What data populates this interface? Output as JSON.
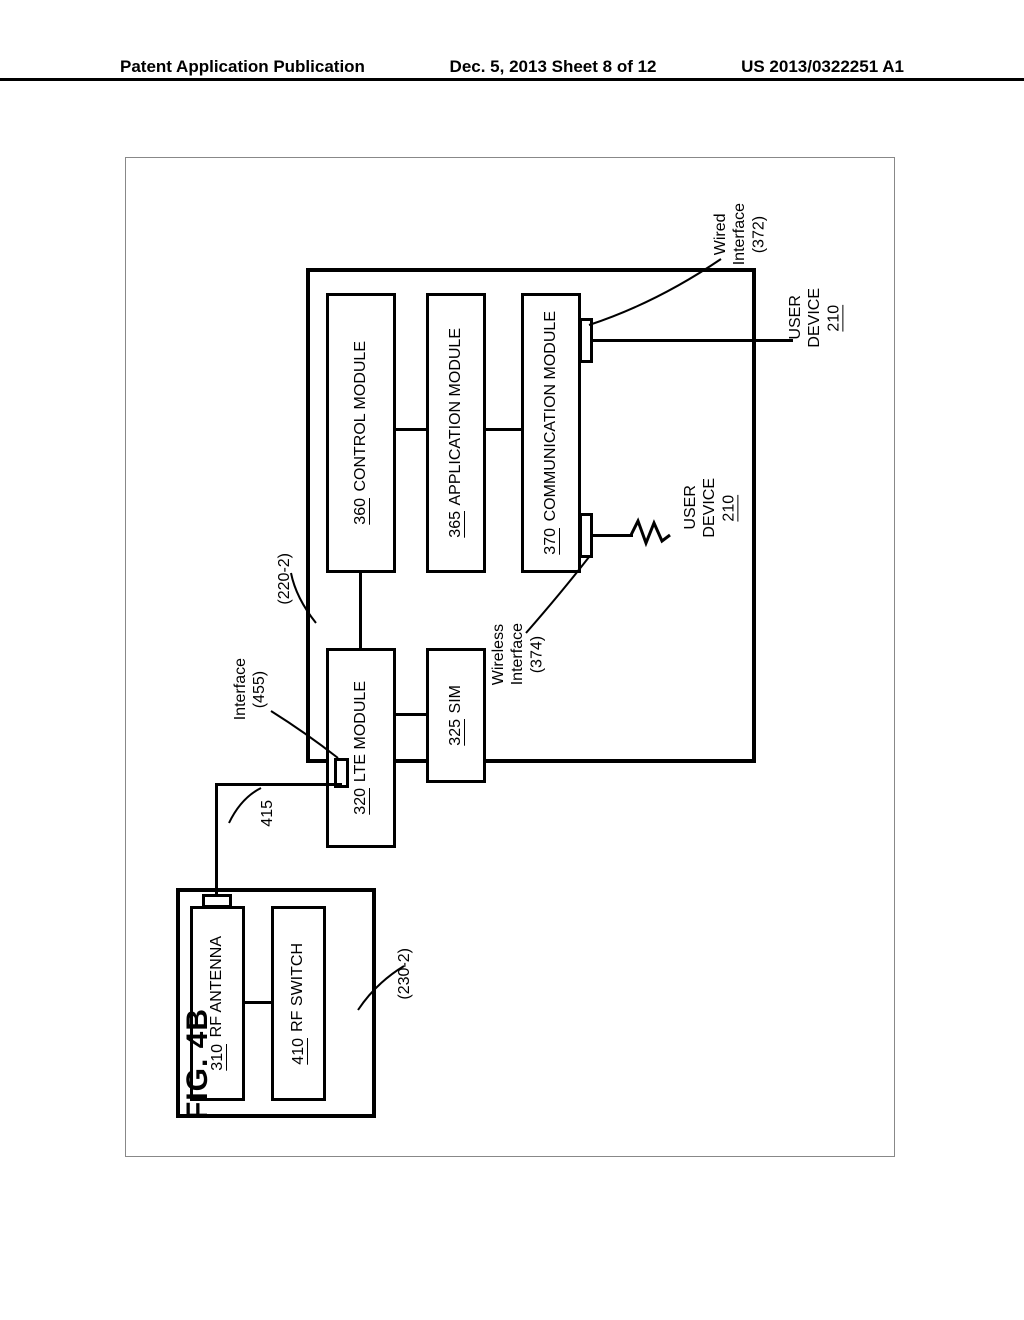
{
  "header": {
    "left": "Patent Application Publication",
    "center": "Dec. 5, 2013  Sheet 8 of 12",
    "right": "US 2013/0322251 A1"
  },
  "figure_label": "FIG. 4B",
  "container_refs": {
    "outdoor": "(230-2)",
    "indoor": "(220-2)"
  },
  "cable_ref": "415",
  "interface_label": "Interface",
  "interface_ref": "(455)",
  "wireless_iface_label": "Wireless\nInterface",
  "wireless_iface_ref": "(374)",
  "wired_iface_label": "Wired\nInterface",
  "wired_iface_ref": "(372)",
  "boxes": {
    "rf_antenna": {
      "label": "RF ANTENNA",
      "ref": "310"
    },
    "rf_switch": {
      "label": "RF SWITCH",
      "ref": "410"
    },
    "lte_module": {
      "label": "LTE MODULE",
      "ref": "320"
    },
    "sim": {
      "label": "SIM",
      "ref": "325"
    },
    "control_module": {
      "label": "CONTROL MODULE",
      "ref": "360"
    },
    "application_module": {
      "label": "APPLICATION MODULE",
      "ref": "365"
    },
    "communication_module": {
      "label": "COMMUNICATION\nMODULE",
      "ref": "370"
    }
  },
  "user_device_upper": {
    "label": "USER\nDEVICE",
    "ref": "210"
  },
  "user_device_lower": {
    "label": "USER\nDEVICE",
    "ref": "210"
  }
}
